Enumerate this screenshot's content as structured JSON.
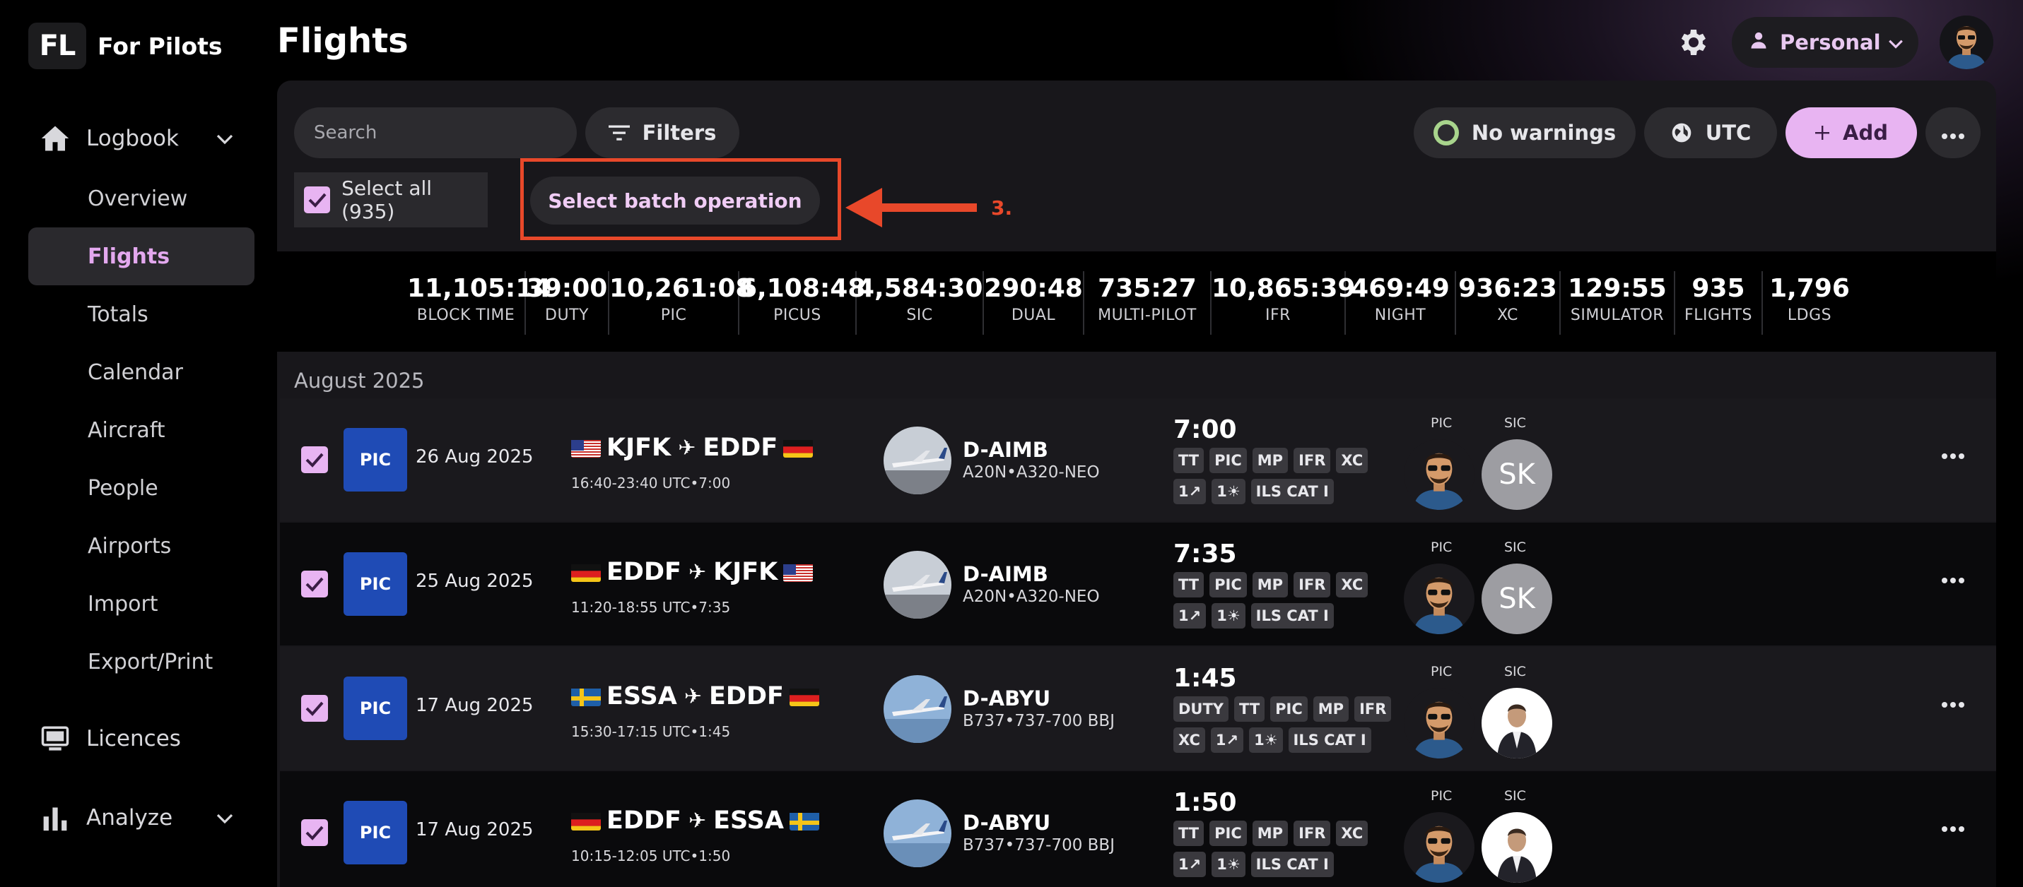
{
  "brand": {
    "logo": "FL",
    "name": "For Pilots"
  },
  "sidebar": {
    "logbook": {
      "label": "Logbook",
      "icon": "home-icon"
    },
    "items": [
      {
        "label": "Overview",
        "active": false
      },
      {
        "label": "Flights",
        "active": true
      },
      {
        "label": "Totals",
        "active": false
      },
      {
        "label": "Calendar",
        "active": false
      },
      {
        "label": "Aircraft",
        "active": false
      },
      {
        "label": "People",
        "active": false
      },
      {
        "label": "Airports",
        "active": false
      },
      {
        "label": "Import",
        "active": false
      },
      {
        "label": "Export/Print",
        "active": false
      }
    ],
    "licences": {
      "label": "Licences",
      "icon": "licence-icon"
    },
    "analyze": {
      "label": "Analyze",
      "icon": "bar-chart-icon"
    }
  },
  "header": {
    "title": "Flights",
    "profile_label": "Personal"
  },
  "toolbar": {
    "search_placeholder": "Search",
    "filters_label": "Filters",
    "warnings_label": "No warnings",
    "timezone_label": "UTC",
    "add_label": "Add",
    "select_all_label": "Select all (935)",
    "batch_label": "Select batch operation"
  },
  "annotation": {
    "step": "3.",
    "color": "#e8482a"
  },
  "stats": [
    {
      "value": "11,105:14",
      "label": "BLOCK TIME"
    },
    {
      "value": "39:00",
      "label": "DUTY"
    },
    {
      "value": "10,261:08",
      "label": "PIC"
    },
    {
      "value": "6,108:48",
      "label": "PICUS"
    },
    {
      "value": "4,584:30",
      "label": "SIC"
    },
    {
      "value": "290:48",
      "label": "DUAL"
    },
    {
      "value": "735:27",
      "label": "MULTI-PILOT"
    },
    {
      "value": "10,865:39",
      "label": "IFR"
    },
    {
      "value": "469:49",
      "label": "NIGHT"
    },
    {
      "value": "936:23",
      "label": "XC"
    },
    {
      "value": "129:55",
      "label": "SIMULATOR"
    },
    {
      "value": "935",
      "label": "FLIGHTS"
    },
    {
      "value": "1,796",
      "label": "LDGS"
    }
  ],
  "month": "August 2025",
  "flights": [
    {
      "role": "PIC",
      "date": "26 Aug 2025",
      "from": "KJFK",
      "to": "EDDF",
      "from_flag": "us",
      "to_flag": "de",
      "times": "16:40-23:40 UTC•7:00",
      "registration": "D-AIMB",
      "type": "A20N•A320-NEO",
      "duration": "7:00",
      "tags": [
        "TT",
        "PIC",
        "MP",
        "IFR",
        "XC",
        "1↗",
        "1☀",
        "ILS CAT I"
      ],
      "crew_pic": "PIC",
      "crew_sic": "SIC",
      "sic_initials": "SK"
    },
    {
      "role": "PIC",
      "date": "25 Aug 2025",
      "from": "EDDF",
      "to": "KJFK",
      "from_flag": "de",
      "to_flag": "us",
      "times": "11:20-18:55 UTC•7:35",
      "registration": "D-AIMB",
      "type": "A20N•A320-NEO",
      "duration": "7:35",
      "tags": [
        "TT",
        "PIC",
        "MP",
        "IFR",
        "XC",
        "1↗",
        "1☀",
        "ILS CAT I"
      ],
      "crew_pic": "PIC",
      "crew_sic": "SIC",
      "sic_initials": "SK"
    },
    {
      "role": "PIC",
      "date": "17 Aug 2025",
      "from": "ESSA",
      "to": "EDDF",
      "from_flag": "se",
      "to_flag": "de",
      "times": "15:30-17:15 UTC•1:45",
      "registration": "D-ABYU",
      "type": "B737•737-700 BBJ",
      "duration": "1:45",
      "tags": [
        "DUTY",
        "TT",
        "PIC",
        "MP",
        "IFR",
        "XC",
        "1↗",
        "1☀",
        "ILS CAT I"
      ],
      "crew_pic": "PIC",
      "crew_sic": "SIC",
      "sic_initials": ""
    },
    {
      "role": "PIC",
      "date": "17 Aug 2025",
      "from": "EDDF",
      "to": "ESSA",
      "from_flag": "de",
      "to_flag": "se",
      "times": "10:15-12:05 UTC•1:50",
      "registration": "D-ABYU",
      "type": "B737•737-700 BBJ",
      "duration": "1:50",
      "tags": [
        "TT",
        "PIC",
        "MP",
        "IFR",
        "XC",
        "1↗",
        "1☀",
        "ILS CAT I"
      ],
      "crew_pic": "PIC",
      "crew_sic": "SIC",
      "sic_initials": ""
    }
  ]
}
